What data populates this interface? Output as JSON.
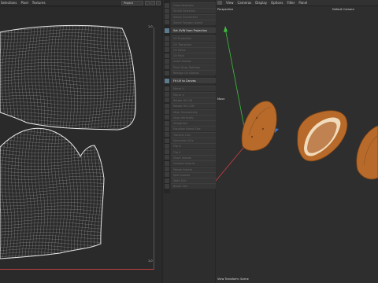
{
  "uv_editor": {
    "menu": [
      "Selections",
      "Pixel",
      "Textures"
    ],
    "project_select": "Project",
    "corner_top_label": "1.0",
    "corner_bottom_label": "1.0"
  },
  "tools": {
    "items": [
      {
        "label": "Grow Selection",
        "header": false
      },
      {
        "label": "Shrink Selection",
        "header": false
      },
      {
        "label": "Select Connected",
        "header": false
      },
      {
        "label": "Select Polygon Island",
        "header": false
      },
      {
        "label": "Set UVW from Projection",
        "header": true
      },
      {
        "label": "UV Projection",
        "header": false
      },
      {
        "label": "UV Transform",
        "header": false
      },
      {
        "label": "UV Relax",
        "header": false
      },
      {
        "label": "UV Pack",
        "header": false
      },
      {
        "label": "Auto Unwrap",
        "header": false
      },
      {
        "label": "Point Snap Settings",
        "header": false
      },
      {
        "label": "Realign UV Islands",
        "header": false
      },
      {
        "label": "Fit UV to Canvas",
        "header": true
      },
      {
        "label": "Mirror U",
        "header": false
      },
      {
        "label": "Mirror V",
        "header": false
      },
      {
        "label": "Rotate 90 CW",
        "header": false
      },
      {
        "label": "Rotate 90 CCW",
        "header": false
      },
      {
        "label": "Align Horizontally",
        "header": false
      },
      {
        "label": "Align Vertically",
        "header": false
      },
      {
        "label": "Straighten",
        "header": false
      },
      {
        "label": "Equalize Island Size",
        "header": false
      },
      {
        "label": "Transfer UVs",
        "header": false
      },
      {
        "label": "Normalize UVs",
        "header": false
      },
      {
        "label": "Flip U",
        "header": false
      },
      {
        "label": "Flip V",
        "header": false
      },
      {
        "label": "Stack Islands",
        "header": false
      },
      {
        "label": "Unstack Islands",
        "header": false
      },
      {
        "label": "Merge Islands",
        "header": false
      },
      {
        "label": "Split Islands",
        "header": false
      },
      {
        "label": "Weld UVs",
        "header": false
      },
      {
        "label": "Break UVs",
        "header": false
      }
    ]
  },
  "viewport": {
    "menu": [
      "View",
      "Cameras",
      "Display",
      "Options",
      "Filter",
      "Panel"
    ],
    "projection_label": "Perspective",
    "camera_label": "Default Camera",
    "tool_label": "Move",
    "status_text": "View Transform: Scene"
  },
  "colors": {
    "axis_x": "#d04040",
    "axis_y": "#3fbf3f",
    "axis_z": "#3a7ad8",
    "almond_shell": "#b86a2a",
    "almond_kernel": "#c08250"
  }
}
